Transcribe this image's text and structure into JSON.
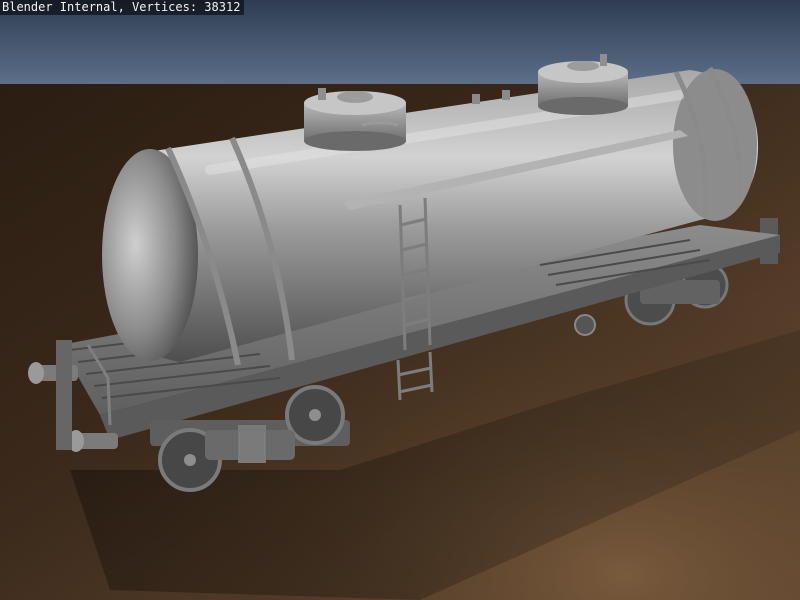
{
  "render": {
    "status_text": "Blender Internal, Vertices: 38312"
  },
  "colors": {
    "sky_top": "#2f3f55",
    "sky_bottom": "#5b6f8a",
    "ground_near": "#6a4e33",
    "ground_far": "#2a1d12",
    "tank_light": "#c9c9c9",
    "tank_mid": "#8f8f8f",
    "tank_dark": "#4f4f4f",
    "frame": "#6b6b6b"
  }
}
